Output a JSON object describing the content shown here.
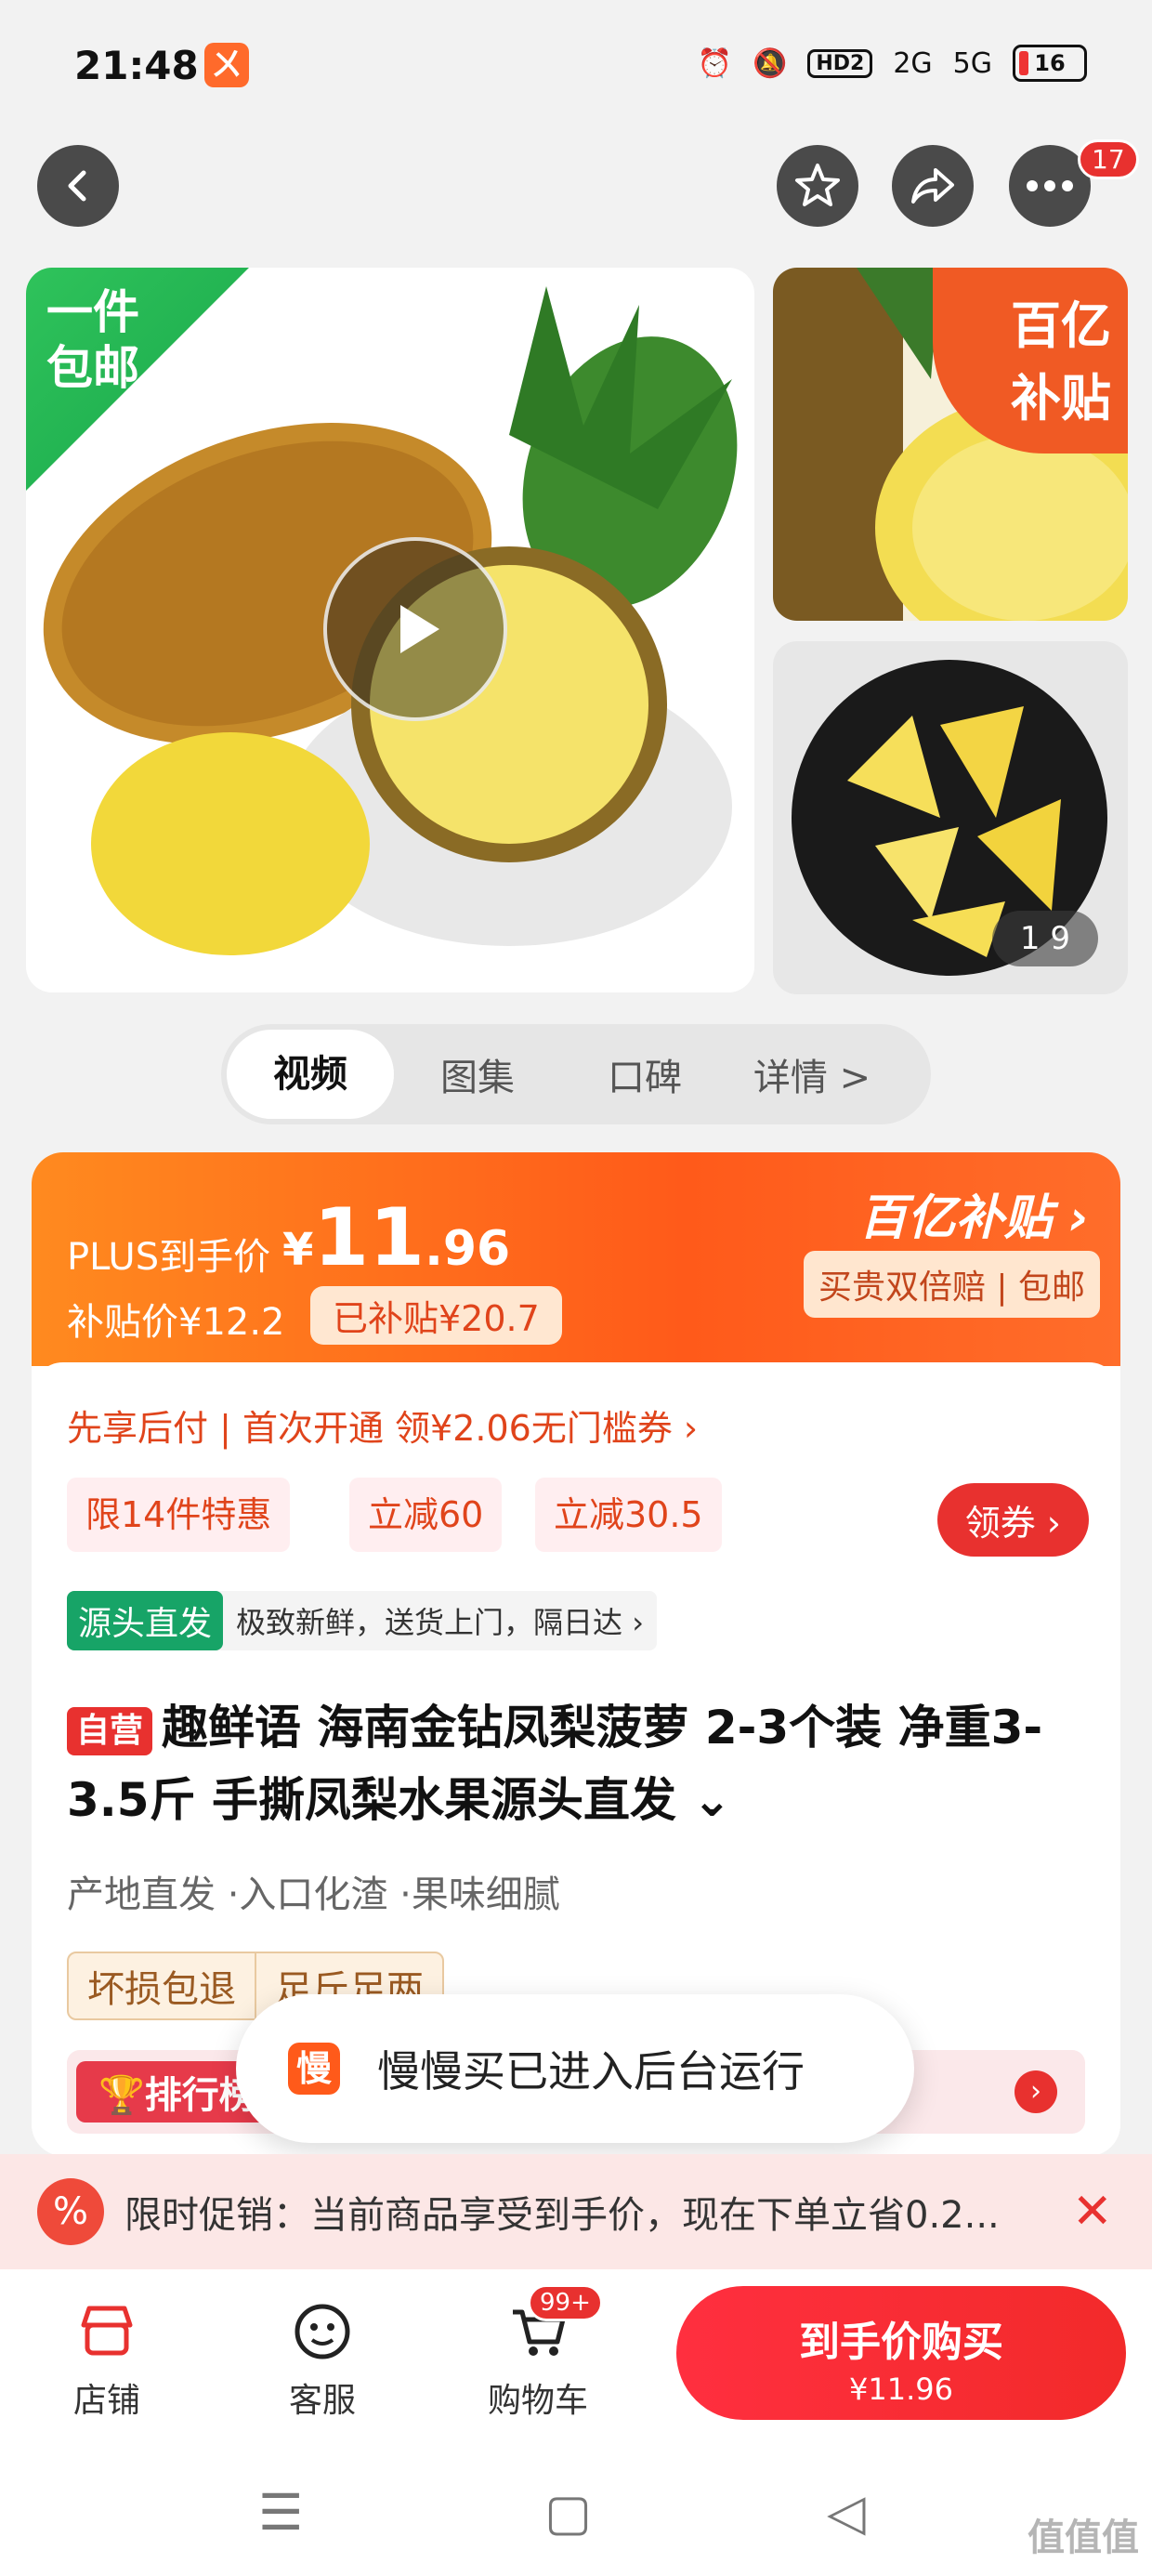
{
  "status_bar": {
    "time": "21:48",
    "app_icon": "ㄨ",
    "icons": [
      "alarm-icon",
      "mute-icon",
      "hd2-icon",
      "signal-2g-icon",
      "signal-5g-icon"
    ],
    "hd_label": "HD2",
    "net1": "2G",
    "net2": "5G",
    "battery": "16"
  },
  "top_nav": {
    "back": "❮",
    "favorite": "☆",
    "share": "➦",
    "more": "•••",
    "badge": "17"
  },
  "gallery": {
    "ribbon": [
      "一件",
      "包邮"
    ],
    "subsidy_tag": [
      "百亿",
      "补贴"
    ],
    "counter": "1  9"
  },
  "media_tabs": [
    "视频",
    "图集",
    "口碑",
    "详情 >"
  ],
  "price": {
    "plus_label": "PLUS到手价",
    "currency": "¥",
    "plus_int": "11",
    "plus_dec": ".96",
    "subsidy_price": "补贴价¥12.2",
    "subsidy_saved": "已补贴¥20.7",
    "yi_logo": "百亿补贴 ›",
    "guarantee": "买贵双倍赔 | 包邮"
  },
  "credit_line": "先享后付 | 首次开通 领¥2.06无门槛券 ›",
  "promos": [
    "限14件特惠",
    "立减60",
    "立减30.5"
  ],
  "coupon_button": "领券 ›",
  "source": {
    "tag": "源头直发",
    "desc": "极致新鲜，送货上门，隔日达 ›"
  },
  "title": {
    "self_tag": "自营",
    "text": "趣鲜语 海南金钻凤梨菠萝 2-3个装 净重3-3.5斤 手撕凤梨水果源头直发 ⌄"
  },
  "features": "产地直发 ·入口化渣 ·果味细腻",
  "service_tags": [
    "坏损包退",
    "足斤足两"
  ],
  "rank_label": "🏆排行榜",
  "toast": {
    "icon": "慢",
    "text": "慢慢买已进入后台运行"
  },
  "promo_strip": {
    "icon": "%",
    "text": "限时促销：当前商品享受到手价，现在下单立省0.2...",
    "close": "✕"
  },
  "bottom_bar": {
    "shop": "店铺",
    "service": "客服",
    "cart": "购物车",
    "cart_badge": "99+",
    "buy_line1": "到手价购买",
    "buy_line2": "¥11.96"
  },
  "system_nav": {
    "menu": "☰",
    "home": "▢",
    "back": "◁",
    "watermark": "值值值"
  }
}
